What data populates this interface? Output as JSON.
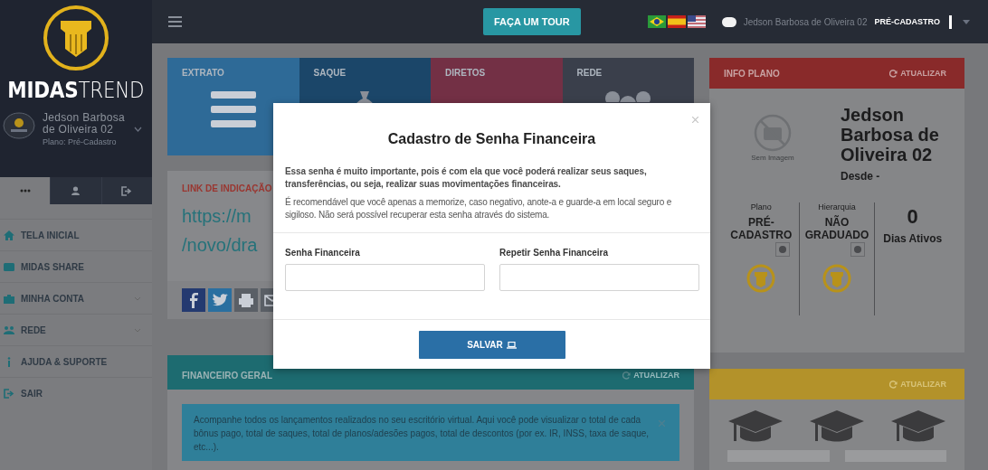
{
  "topbar": {
    "tour_button": "FAÇA UM TOUR",
    "user_name": "Jedson Barbosa de Oliveira 02",
    "plan": "PRÉ-CADASTRO"
  },
  "sidebar": {
    "brand": "**MIDAS**TREND",
    "user_name": "Jedson Barbosa de Oliveira 02",
    "user_plan": "Plano: Pré-Cadastro",
    "tabs": [
      {
        "selected": true
      },
      {
        "selected": false
      },
      {
        "selected": false
      }
    ],
    "menu": [
      {
        "label": "TELA INICIAL",
        "kind": "link"
      },
      {
        "label": "MIDAS SHARE",
        "kind": "link"
      },
      {
        "label": "MINHA CONTA",
        "kind": "group"
      },
      {
        "label": "REDE",
        "kind": "group"
      },
      {
        "label": "AJUDA & SUPORTE",
        "kind": "link"
      },
      {
        "label": "SAIR",
        "kind": "link"
      }
    ]
  },
  "tiles": [
    {
      "label": "EXTRATO",
      "color": "#2e6a97"
    },
    {
      "label": "SAQUE",
      "color": "#1b4669"
    },
    {
      "label": "DIRETOS",
      "color": "#733045"
    },
    {
      "label": "REDE",
      "color": "#3a3f4b"
    }
  ],
  "referral": {
    "title": "LINK DE INDICAÇÃO",
    "url_lines": [
      "https://m",
      "/novo/dra"
    ]
  },
  "finance": {
    "title": "FINANCEIRO GERAL",
    "refresh": "ATUALIZAR",
    "notice": "Acompanhe todos os lançamentos realizados no seu escritório virtual. Aqui você pode visualizar o total de cada bônus pago, total de saques, total de planos/adesões pagos, total de descontos (por ex. IR, INSS, taxa de saque, etc...)."
  },
  "plan_info": {
    "title": "INFO PLANO",
    "refresh": "ATUALIZAR",
    "photo_caption": "Sem Imagem",
    "name": "Jedson Barbosa de Oliveira 02",
    "since": "Desde -",
    "stats": [
      {
        "kind": "badge",
        "label": "Plano",
        "value": "PRÉ-CADASTRO"
      },
      {
        "kind": "badge",
        "label": "Hierarquia",
        "value": "NÃO GRADUADO"
      },
      {
        "kind": "count",
        "value": "0",
        "label": "Dias Ativos"
      }
    ]
  },
  "ranks": {
    "refresh": "ATUALIZAR"
  },
  "modal": {
    "title": "Cadastro de Senha Financeira",
    "intro": "Essa senha é muito importante, pois é com ela que você poderá realizar seus saques, transferências, ou seja, realizar suas movimentações financeiras.",
    "note": "É recomendável que você apenas a memorize, caso negativo, anote-a e guarde-a em local seguro e sigiloso. Não será possível recuperar esta senha através do sistema.",
    "fields": [
      {
        "label": "Senha Financeira"
      },
      {
        "label": "Repetir Senha Financeira"
      }
    ],
    "save_button": "SALVAR"
  }
}
